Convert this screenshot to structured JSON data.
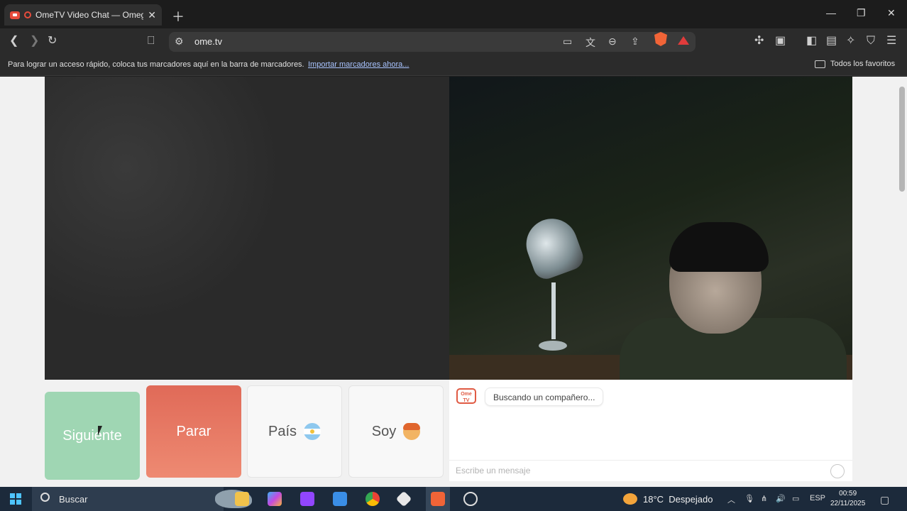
{
  "browser": {
    "tab_title": "OmeTV Video Chat — Omegl",
    "url": "ome.tv",
    "bookmarks_hint": "Para lograr un acceso rápido, coloca tus marcadores aquí en la barra de marcadores.",
    "bookmarks_import": "Importar marcadores ahora...",
    "bookmarks_all": "Todos los favoritos"
  },
  "controls": {
    "next": "Siguiente",
    "stop": "Parar",
    "country": "País",
    "iam": "Soy"
  },
  "chat": {
    "logo": "Ome TV",
    "status": "Buscando un compañero...",
    "placeholder": "Escribe un mensaje"
  },
  "taskbar": {
    "search": "Buscar",
    "weather_temp": "18°C",
    "weather_desc": "Despejado",
    "lang": "ESP",
    "time": "00:59",
    "date": "22/11/2025"
  },
  "colors": {
    "next": "#9fd6b3",
    "stop": "#e06a58",
    "brand": "#e05a43"
  },
  "icons": [
    "back-icon",
    "forward-icon",
    "reload-icon",
    "bookmark-icon",
    "site-settings-icon",
    "cast-icon",
    "translate-icon",
    "zoom-icon",
    "share-icon",
    "brave-shield-icon",
    "brave-rewards-icon",
    "extensions-icon",
    "sidebar-icon",
    "wallet-icon",
    "leo-icon",
    "vpn-icon",
    "menu-icon"
  ]
}
